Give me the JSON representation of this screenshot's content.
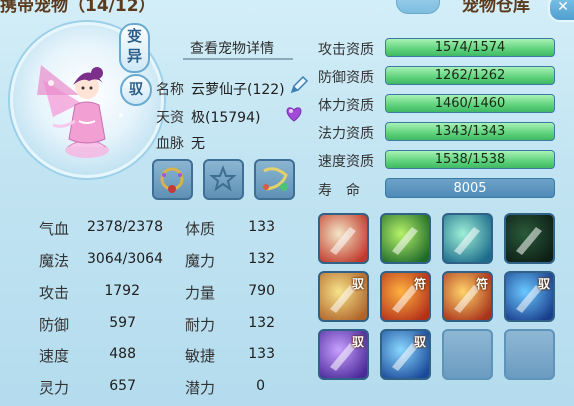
{
  "header": {
    "left_title": "携带宠物（14/12）",
    "right_title": "宠物仓库",
    "close_glyph": "✕"
  },
  "avatar": {
    "mutate_label": "变异",
    "ride_label": "驭"
  },
  "detail_link": "查看宠物详情",
  "info": {
    "name_label": "名称",
    "name_value": "云萝仙子(122)",
    "quality_label": "天资",
    "quality_value": "极(15794)",
    "bloodline_label": "血脉",
    "bloodline_value": "无"
  },
  "equipment": [
    {
      "name": "necklace-equip",
      "icon": "necklace-icon"
    },
    {
      "name": "empty-equip",
      "icon": "star-icon"
    },
    {
      "name": "bracelet-equip",
      "icon": "bracelet-icon"
    }
  ],
  "aptitudes": [
    {
      "label": "攻击资质",
      "value": "1574/1574",
      "fill": 1.0
    },
    {
      "label": "防御资质",
      "value": "1262/1262",
      "fill": 1.0
    },
    {
      "label": "体力资质",
      "value": "1460/1460",
      "fill": 1.0
    },
    {
      "label": "法力资质",
      "value": "1343/1343",
      "fill": 1.0
    },
    {
      "label": "速度资质",
      "value": "1538/1538",
      "fill": 1.0
    }
  ],
  "life": {
    "label": "寿　命",
    "value": "8005"
  },
  "stats_left": [
    {
      "label": "气血",
      "value": "2378/2378"
    },
    {
      "label": "魔法",
      "value": "3064/3064"
    },
    {
      "label": "攻击",
      "value": "1792"
    },
    {
      "label": "防御",
      "value": "597"
    },
    {
      "label": "速度",
      "value": "488"
    },
    {
      "label": "灵力",
      "value": "657"
    }
  ],
  "stats_right": [
    {
      "label": "体质",
      "value": "133"
    },
    {
      "label": "魔力",
      "value": "132"
    },
    {
      "label": "力量",
      "value": "790"
    },
    {
      "label": "耐力",
      "value": "132"
    },
    {
      "label": "敏捷",
      "value": "133"
    },
    {
      "label": "潜力",
      "value": "0"
    }
  ],
  "skills": [
    {
      "name": "sword-skill",
      "tag": "",
      "colors": [
        "#f3e6c6",
        "#c0392b"
      ]
    },
    {
      "name": "shadow-strike-skill",
      "tag": "",
      "colors": [
        "#b6f26a",
        "#1f6a2a"
      ]
    },
    {
      "name": "stealth-skill",
      "tag": "",
      "colors": [
        "#9ef0d6",
        "#1c6b8c"
      ]
    },
    {
      "name": "night-slash-skill",
      "tag": "",
      "colors": [
        "#2a5a3a",
        "#0d1e14"
      ]
    },
    {
      "name": "boot-skill",
      "tag": "驭",
      "colors": [
        "#f7e38a",
        "#b0642a"
      ]
    },
    {
      "name": "rage-skill",
      "tag": "符",
      "colors": [
        "#ffb340",
        "#b4301a"
      ]
    },
    {
      "name": "talisman-skill",
      "tag": "符",
      "colors": [
        "#ffd36a",
        "#a8321a"
      ]
    },
    {
      "name": "bird-skill",
      "tag": "驭",
      "colors": [
        "#6ac8ff",
        "#1a3e8c"
      ]
    },
    {
      "name": "crystal-skill",
      "tag": "驭",
      "colors": [
        "#c8a0ff",
        "#4a2a9a"
      ]
    },
    {
      "name": "fish-skill",
      "tag": "驭",
      "colors": [
        "#8ad8ff",
        "#1a4a9a"
      ]
    },
    {
      "name": "empty-skill-1",
      "tag": "",
      "colors": []
    },
    {
      "name": "empty-skill-2",
      "tag": "",
      "colors": []
    }
  ]
}
